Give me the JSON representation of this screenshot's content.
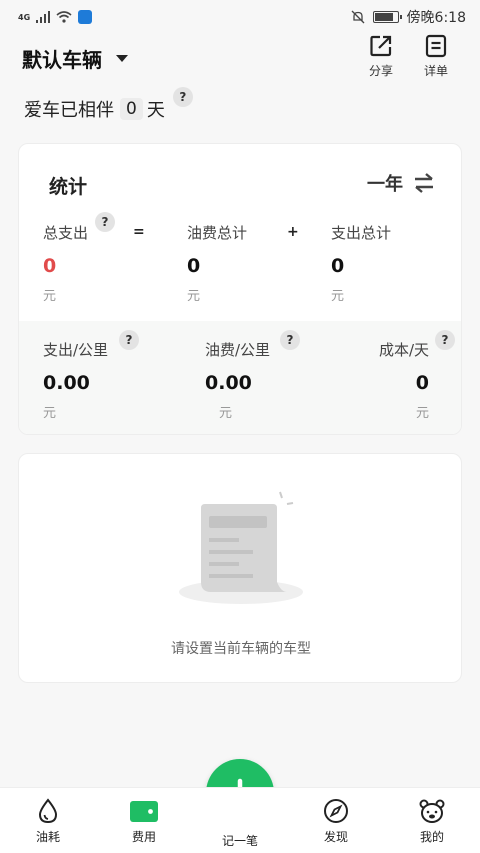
{
  "status": {
    "net": "4G",
    "time": "傍晚6:18",
    "battery_level": 0.85
  },
  "header": {
    "car_name": "默认车辆",
    "share_label": "分享",
    "detail_label": "详单"
  },
  "days": {
    "prefix": "爱车已相伴",
    "count": "0",
    "suffix": "天"
  },
  "help_mark": "?",
  "stats": {
    "title": "统计",
    "period": "一年",
    "total": {
      "label": "总支出",
      "value": "0",
      "unit": "元"
    },
    "fuel": {
      "label": "油费总计",
      "value": "0",
      "unit": "元"
    },
    "expense": {
      "label": "支出总计",
      "value": "0",
      "unit": "元"
    },
    "op_equal": "=",
    "op_plus": "+",
    "per_km": {
      "label": "支出/公里",
      "value": "0.00",
      "unit": "元"
    },
    "fuel_per_km": {
      "label": "油费/公里",
      "value": "0.00",
      "unit": "元"
    },
    "cost_per_day": {
      "label": "成本/天",
      "value": "0",
      "unit": "元"
    }
  },
  "empty": {
    "text": "请设置当前车辆的车型"
  },
  "tabs": {
    "fuel": "油耗",
    "cost": "费用",
    "record": "记一笔",
    "discover": "发现",
    "mine": "我的"
  },
  "colors": {
    "accent": "#1fbd64",
    "red": "#e14b4b"
  }
}
